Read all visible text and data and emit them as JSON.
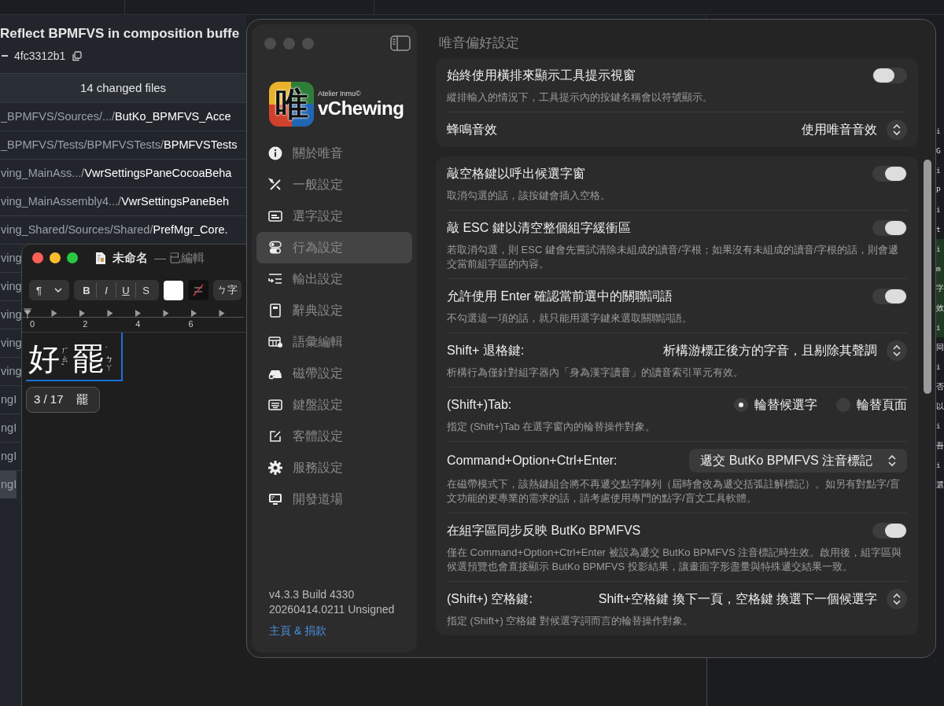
{
  "background_app": {
    "commit_title": "Reflect BPMFVS in composition buffe",
    "commit_hash": "4fc3312b1",
    "files_header": "14 changed files",
    "files": [
      {
        "path": "_BPMFVS/Sources/.../",
        "name": "ButKo_BPMFVS_Acce",
        "selected": false
      },
      {
        "path": "_BPMFVS/Tests/BPMFVSTests/",
        "name": "BPMFVSTests",
        "selected": false
      },
      {
        "path": "ving_MainAss.../",
        "name": "VwrSettingsPaneCocoaBeha",
        "selected": false
      },
      {
        "path": "ving_MainAssembly4.../",
        "name": "VwrSettingsPaneBeh",
        "selected": false
      },
      {
        "path": "ving_Shared/Sources/Shared/",
        "name": "PrefMgr_Core.",
        "selected": false
      },
      {
        "path": "ving",
        "selected": false
      },
      {
        "path": "ving",
        "selected": false
      },
      {
        "path": "ving",
        "selected": false
      },
      {
        "path": "ving",
        "selected": false
      },
      {
        "path": "ving",
        "selected": false
      },
      {
        "path": "ngI",
        "selected": false
      },
      {
        "path": "ngI",
        "selected": false
      },
      {
        "path": "ngI",
        "selected": false
      },
      {
        "path": "ngI",
        "selected": true
      }
    ]
  },
  "code_strip": [
    {
      "text": "i",
      "added": false
    },
    {
      "text": "G",
      "added": false
    },
    {
      "text": "i",
      "added": false
    },
    {
      "text": "P",
      "added": false
    },
    {
      "text": "i",
      "added": false
    },
    {
      "text": "t",
      "added": false
    },
    {
      "text": "i",
      "added": true
    },
    {
      "text": "m",
      "added": true
    },
    {
      "text": "字",
      "added": true
    },
    {
      "text": "效",
      "added": true
    },
    {
      "text": "i",
      "added": true
    },
    {
      "text": "同",
      "added": false
    },
    {
      "text": "i",
      "added": false
    },
    {
      "text": "否",
      "added": false
    },
    {
      "text": "以",
      "added": false
    },
    {
      "text": "i",
      "added": false
    },
    {
      "text": "吾",
      "added": false
    },
    {
      "text": "i",
      "added": false
    },
    {
      "text": "選",
      "added": false
    }
  ],
  "textedit": {
    "title": "未命名",
    "status": "— 已編輯",
    "toolbar": {
      "paragraph": "¶",
      "bold": "B",
      "italic": "I",
      "underline": "U",
      "strike": "S",
      "input_button": "ㄅ字"
    },
    "ruler": [
      "0",
      "2",
      "4",
      "6"
    ],
    "composition": [
      {
        "kind": "hanzi",
        "text": "好"
      },
      {
        "kind": "zhuyin",
        "text": "ㄏㄠˇ"
      },
      {
        "kind": "hanzi",
        "text": "罷"
      },
      {
        "kind": "zhuyin",
        "text": "˙ㄅㄚ"
      }
    ],
    "candidate": {
      "count": "3 / 17",
      "text": "罷"
    }
  },
  "settings": {
    "logo": {
      "glyph": "唯",
      "maker": "Atelier Inmu©",
      "name": "vChewing"
    },
    "sidebar": [
      {
        "label": "關於唯音",
        "selected": false
      },
      {
        "label": "一般設定",
        "selected": false
      },
      {
        "label": "選字設定",
        "selected": false
      },
      {
        "label": "行為設定",
        "selected": true
      },
      {
        "label": "輸出設定",
        "selected": false
      },
      {
        "label": "辭典設定",
        "selected": false
      },
      {
        "label": "語彙編輯",
        "selected": false
      },
      {
        "label": "磁帶設定",
        "selected": false
      },
      {
        "label": "鍵盤設定",
        "selected": false
      },
      {
        "label": "客體設定",
        "selected": false
      },
      {
        "label": "服務設定",
        "selected": false
      },
      {
        "label": "開發道場",
        "selected": false
      }
    ],
    "version": [
      "v4.3.3 Build 4330",
      "20260414.0211 Unsigned"
    ],
    "link": "主頁 & 捐款",
    "title": "唯音偏好設定",
    "cards": [
      [
        {
          "kind": "toggle",
          "title": "始終使用橫排來顯示工具提示視窗",
          "desc": "縱排輸入的情況下，工具提示內的按鍵名稱會以符號顯示。",
          "on": false
        },
        {
          "kind": "popup",
          "title": "蜂鳴音效",
          "value": "使用唯音音效",
          "bordered": false
        }
      ],
      [
        {
          "kind": "toggle",
          "title": "敲空格鍵以呼出候選字窗",
          "desc": "取消勾選的話，該按鍵會插入空格。",
          "on": true
        },
        {
          "kind": "toggle",
          "title": "敲 ESC 鍵以清空整個組字緩衝區",
          "desc": "若取消勾選，則 ESC 鍵會先嘗試清除未組成的讀音/字根；如果沒有未組成的讀音/字根的話，則會遞交當前組字區的內容。",
          "on": true
        },
        {
          "kind": "toggle",
          "title": "允許使用 Enter 確認當前選中的關聯詞語",
          "desc": "不勾選這一項的話，就只能用選字鍵來選取關聯詞語。",
          "on": true
        },
        {
          "kind": "popup",
          "title": "Shift+ 退格鍵:",
          "value": "析構游標正後方的字音，且剔除其聲調",
          "bordered": false,
          "desc": "析構行為僅針對組字器內「身為漢字讀音」的讀音索引單元有效。"
        },
        {
          "kind": "radio",
          "title": "(Shift+)Tab:",
          "options": [
            {
              "label": "輪替候選字",
              "selected": true
            },
            {
              "label": "輪替頁面",
              "selected": false
            }
          ],
          "desc": "指定 (Shift+)Tab 在選字窗內的輪替操作對象。"
        },
        {
          "kind": "popup",
          "title": "Command+Option+Ctrl+Enter:",
          "value": "遞交 ButKo BPMFVS 注音標記",
          "bordered": true,
          "desc": "在磁帶模式下，該熱鍵組合將不再遞交點字陣列（屆時會改為遞交括弧註解標記）。如另有對點字/盲文功能的更專業的需求的話，請考慮使用專門的點字/盲文工具軟體。"
        },
        {
          "kind": "toggle",
          "title": "在組字區同步反映 ButKo BPMFVS",
          "desc": "僅在 Command+Option+Ctrl+Enter 被設為遞交 ButKo BPMFVS 注音標記時生效。啟用後，組字區與候選預覽也會直接顯示 ButKo BPMFVS 投影結果，讓畫面字形盡量與特殊遞交結果一致。",
          "on": true
        },
        {
          "kind": "popup",
          "title": "(Shift+) 空格鍵:",
          "value": "Shift+空格鍵 換下一頁，空格鍵 換選下一個候選字",
          "bordered": false,
          "desc": "指定 (Shift+) 空格鍵 對候選字詞而言的輪替操作對象。"
        }
      ]
    ]
  }
}
